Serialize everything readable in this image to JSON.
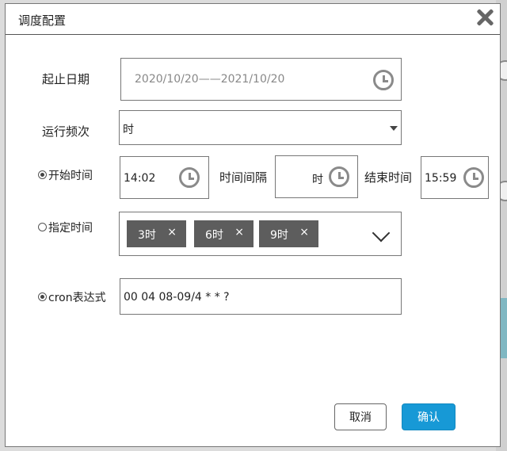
{
  "dialog": {
    "title": "调度配置"
  },
  "form": {
    "date_range": {
      "label": "起止日期",
      "value": "2020/10/20——2021/10/20"
    },
    "frequency": {
      "label": "运行频次",
      "value": "时"
    },
    "start_time": {
      "label": "开始时间",
      "value": "14:02",
      "checked": true
    },
    "interval": {
      "label": "时间间隔",
      "value": "时"
    },
    "end_time": {
      "label": "结束时间",
      "value": "15:59"
    },
    "specified_time": {
      "label": "指定时间",
      "checked": false,
      "tags": [
        "3时",
        "6时",
        "9时"
      ],
      "remove_glyph": "×"
    },
    "cron": {
      "label": "cron表达式",
      "value": "00 04 08-09/4 * * ?",
      "checked": true
    }
  },
  "buttons": {
    "cancel": "取消",
    "confirm": "确认"
  },
  "colors": {
    "confirm": "#1799d6",
    "tag_bg": "#5d5d5d"
  },
  "icons": {
    "close": "close-icon",
    "clock": "clock-icon",
    "dropdown": "caret-down-icon",
    "expand": "chevron-down-icon"
  }
}
